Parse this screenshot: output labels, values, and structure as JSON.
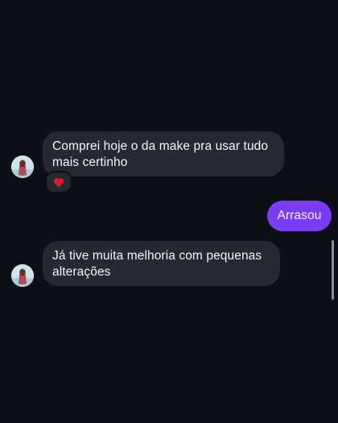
{
  "thread": {
    "messages": [
      {
        "direction": "incoming",
        "text_line1": "Comprei hoje o da make pra usar tudo",
        "text_line2": "mais certinho",
        "reaction": "heart-icon"
      },
      {
        "direction": "outgoing",
        "text": "Arrasou"
      },
      {
        "direction": "incoming",
        "text_line1": "Já tive muita melhoria com pequenas",
        "text_line2": "alterações"
      }
    ]
  },
  "colors": {
    "background": "#0c1014",
    "incoming_bubble": "#262a30",
    "outgoing_bubble": "#7a3cf2",
    "text": "#f5f5f5",
    "reaction_heart": "#e0182d"
  }
}
